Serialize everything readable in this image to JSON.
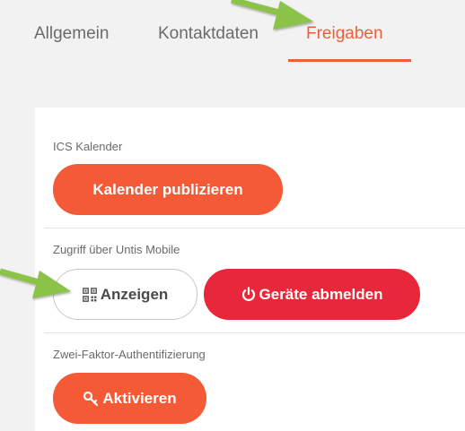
{
  "tabs": [
    {
      "label": "Allgemein",
      "active": false
    },
    {
      "label": "Kontaktdaten",
      "active": false
    },
    {
      "label": "Freigaben",
      "active": true
    }
  ],
  "sections": {
    "ics": {
      "label": "ICS Kalender",
      "button": "Kalender publizieren"
    },
    "mobile": {
      "label": "Zugriff über Untis Mobile",
      "show_button": "Anzeigen",
      "logout_button": "Geräte abmelden"
    },
    "twofa": {
      "label": "Zwei-Faktor-Authentifizierung",
      "button": "Aktivieren"
    }
  },
  "icons": {
    "show": "qr-code-icon",
    "logout": "power-icon",
    "activate": "key-icon",
    "annotation": "arrow-icon"
  },
  "colors": {
    "accent": "#f25c3b",
    "primary_button": "#f45a35",
    "danger_button": "#e8283a",
    "annotation_arrow": "#8bc34a"
  }
}
